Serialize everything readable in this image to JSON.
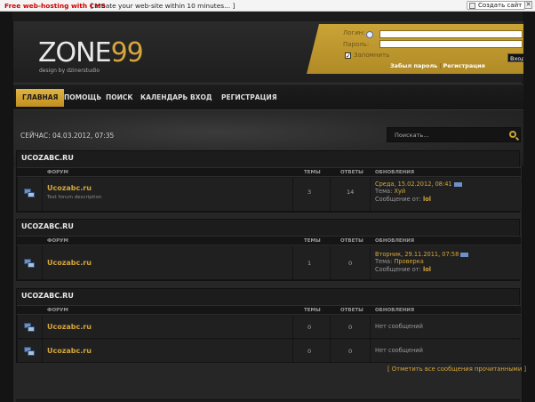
{
  "promo": {
    "hosting": "Free web-hosting with CMS",
    "tagline": "[ create your web-site within 10 minutes... ]",
    "create_button": "Создать сайт",
    "close": "✕"
  },
  "header": {
    "logo_main": "ZONE",
    "logo_num": "99",
    "logo_sub": "design by dzinerstudio"
  },
  "login": {
    "login_label": "Логин:",
    "password_label": "Пароль:",
    "remember_label": "Запомнить",
    "forgot_link": "Забыл пароль",
    "separator": "|",
    "register_link": "Регистрация",
    "submit": "Вход"
  },
  "nav": {
    "items": [
      "Главная",
      "Помощь",
      "Поиск",
      "Календарь",
      "Вход",
      "Регистрация"
    ]
  },
  "banner": {
    "now": "СЕЙЧАС: 04.03.2012, 07:35",
    "search_placeholder": "Поискать..."
  },
  "table_headers": {
    "forum": "Форум",
    "topics": "Темы",
    "replies": "Ответы",
    "updates": "Обновления"
  },
  "sections": [
    {
      "title": "UCOZABC.RU",
      "rows": [
        {
          "name": "Ucozabc.ru",
          "description": "Test forum description",
          "topics": "3",
          "replies": "14",
          "update_date": "Среда, 15.02.2012, 08:41",
          "topic_label": "Тема:",
          "topic_name": "Хуй",
          "by_label": "Сообщение от:",
          "by_nick": "lol"
        }
      ]
    },
    {
      "title": "UCOZABC.RU",
      "rows": [
        {
          "name": "Ucozabc.ru",
          "description": "",
          "topics": "1",
          "replies": "0",
          "update_date": "Вторник, 29.11.2011, 07:58",
          "topic_label": "Тема:",
          "topic_name": "Проверка",
          "by_label": "Сообщение от:",
          "by_nick": "lol"
        }
      ]
    },
    {
      "title": "UCOZABC.RU",
      "rows": [
        {
          "name": "Ucozabc.ru",
          "topics": "0",
          "replies": "0",
          "no_posts": "Нет сообщений"
        },
        {
          "name": "Ucozabc.ru",
          "topics": "0",
          "replies": "0",
          "no_posts": "Нет сообщений"
        }
      ]
    }
  ],
  "mark_all_read": "[ Отметить все сообщения прочитанными ]"
}
